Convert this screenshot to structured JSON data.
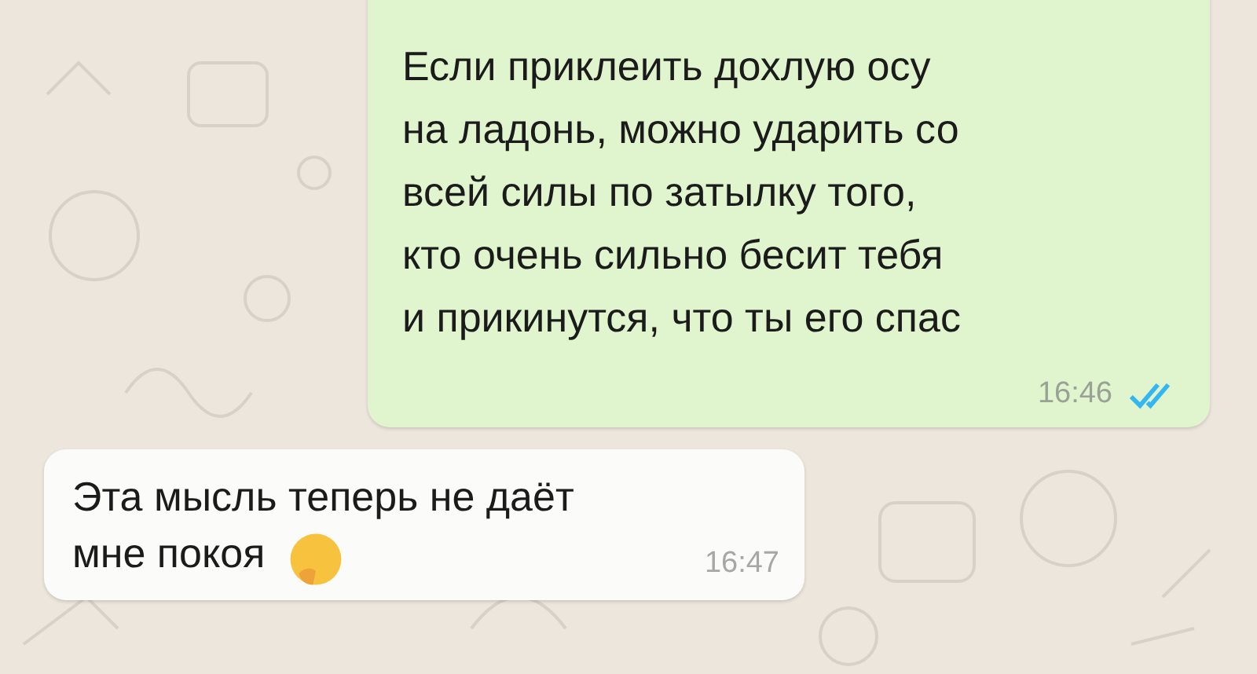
{
  "messages": [
    {
      "kind": "outgoing",
      "lines": [
        "Если приклеить дохлую осу",
        "на ладонь, можно ударить со",
        "всей силы по затылку того,",
        "кто очень сильно бесит тебя",
        "и прикинутся, что ты его спас"
      ],
      "time": "16:46",
      "read": true,
      "emoji": false
    },
    {
      "kind": "incoming",
      "lines": [
        "Эта мысль теперь не даёт",
        "мне покоя"
      ],
      "time": "16:47",
      "emoji": true
    }
  ]
}
